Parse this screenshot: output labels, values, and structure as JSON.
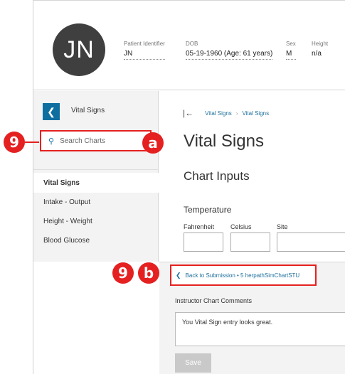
{
  "patient": {
    "initials": "JN",
    "fields": [
      {
        "label": "Patient Identifier",
        "value": "JN"
      },
      {
        "label": "DOB",
        "value": "05-19-1960 (Age: 61 years)"
      },
      {
        "label": "Sex",
        "value": "M"
      },
      {
        "label": "Height",
        "value": "n/a"
      }
    ]
  },
  "sidebar": {
    "back_icon": "chevron-left-icon",
    "title": "Vital Signs",
    "search_placeholder": "Search Charts",
    "items": [
      {
        "label": "Vital Signs",
        "active": true
      },
      {
        "label": "Intake - Output"
      },
      {
        "label": "Height - Weight"
      },
      {
        "label": "Blood Glucose"
      }
    ]
  },
  "main": {
    "breadcrumb": [
      "Vital Signs",
      "Vital Signs"
    ],
    "title": "Vital Signs",
    "subtitle": "Chart Inputs",
    "section": "Temperature",
    "fields": [
      "Fahrenheit",
      "Celsius",
      "Site"
    ]
  },
  "lower": {
    "back_link": "Back to Submission • 5 herpathSimChartSTU",
    "comments_label": "Instructor Chart Comments",
    "comments_text": "You Vital Sign entry looks great.",
    "save_label": "Save"
  },
  "annotations": {
    "step": "9",
    "a": "a",
    "b": "b",
    "color": "#e52020"
  }
}
